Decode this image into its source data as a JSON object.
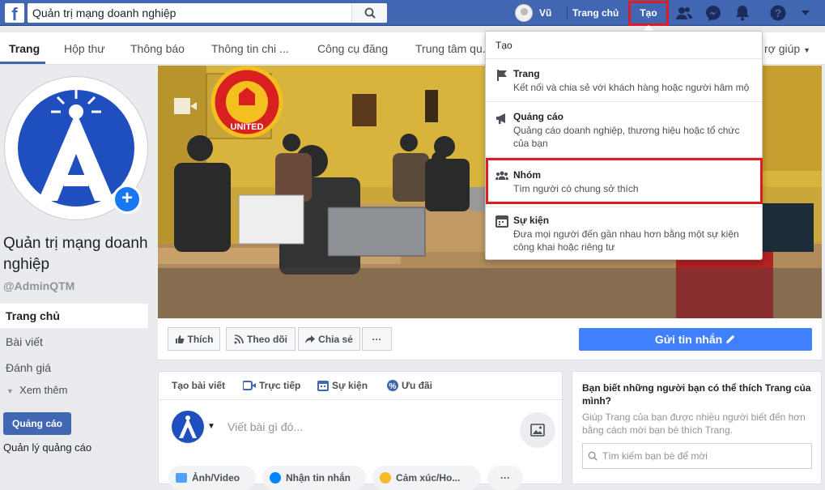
{
  "topbar": {
    "logo": "f",
    "search_value": "Quản trị mạng doanh nghiệp",
    "user_name": "Vũ",
    "home_label": "Trang chủ",
    "create_label": "Tạo"
  },
  "nav": {
    "tabs": [
      "Trang",
      "Hộp thư",
      "Thông báo",
      "Thông tin chi ...",
      "Công cụ đăng",
      "Trung tâm qu...",
      "rợ giúp"
    ]
  },
  "sidebar": {
    "page_name": "Quản trị mạng doanh nghiệp",
    "handle": "@AdminQTM",
    "items": [
      "Trang chủ",
      "Bài viết",
      "Đánh giá"
    ],
    "see_more": "Xem thêm",
    "ad_button": "Quảng cáo",
    "ad_manage": "Quản lý quảng cáo"
  },
  "cover": {
    "crest_text": "UNITED"
  },
  "actions": {
    "like": "Thích",
    "follow": "Theo dõi",
    "share": "Chia sẻ",
    "more": "···",
    "send_message": "Gửi tin nhắn"
  },
  "composer": {
    "tabs": [
      "Tạo bài viết",
      "Trực tiếp",
      "Sự kiện",
      "Ưu đãi"
    ],
    "placeholder": "Viết bài gì đó...",
    "pills": [
      "Ảnh/Video",
      "Nhận tin nhắn",
      "Cảm xúc/Ho...",
      "···"
    ]
  },
  "invite": {
    "title": "Bạn biết những người bạn có thể thích Trang của mình?",
    "subtitle": "Giúp Trang của bạn được nhiều người biết đến hơn bằng cách mời bạn bè thích Trang.",
    "search_placeholder": "Tìm kiếm bạn bè để mời"
  },
  "dropdown": {
    "header": "Tạo",
    "items": [
      {
        "title": "Trang",
        "desc": "Kết nối và chia sẻ với khách hàng hoặc người hâm mộ",
        "icon": "flag-icon"
      },
      {
        "title": "Quảng cáo",
        "desc": "Quảng cáo doanh nghiệp, thương hiệu hoặc tổ chức của bạn",
        "icon": "megaphone-icon"
      },
      {
        "title": "Nhóm",
        "desc": "Tìm người có chung sở thích",
        "icon": "group-icon"
      },
      {
        "title": "Sự kiện",
        "desc": "Đưa mọi người đến gần nhau hơn bằng một sự kiện công khai hoặc riêng tư",
        "icon": "calendar-icon"
      }
    ]
  },
  "colors": {
    "brand": "#4267b2",
    "accent": "#4080ff",
    "highlight": "#e01b24"
  }
}
